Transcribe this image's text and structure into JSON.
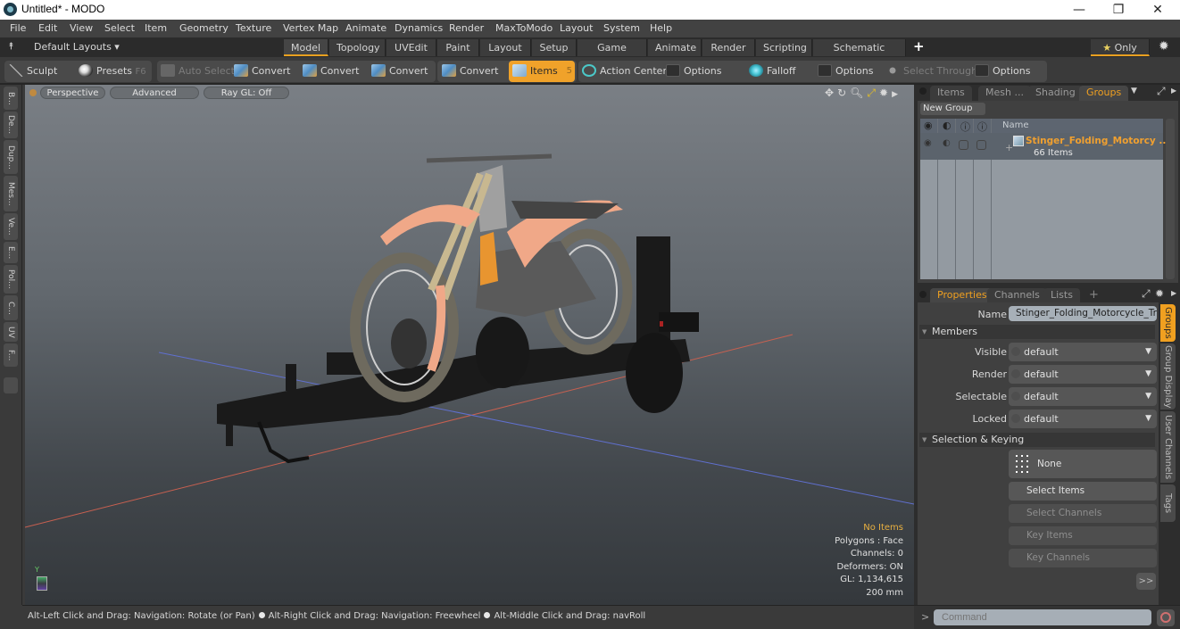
{
  "window": {
    "title": "Untitled* - MODO",
    "controls": {
      "minimize": "—",
      "restore": "❐",
      "close": "✕"
    }
  },
  "menubar": [
    "File",
    "Edit",
    "View",
    "Select",
    "Item",
    "Geometry",
    "Texture",
    "Vertex Map",
    "Animate",
    "Dynamics",
    "Render",
    "MaxToModo",
    "Layout",
    "System",
    "Help"
  ],
  "layoutbar": {
    "layouts_label": "Default Layouts ▾",
    "tabs": [
      "Model",
      "Topology",
      "UVEdit",
      "Paint",
      "Layout",
      "Setup",
      "Game Tools",
      "Animate",
      "Render",
      "Scripting",
      "Schematic Fusion"
    ],
    "active_tab": "Model",
    "add_tab": "+",
    "only_label": "★ Only",
    "accent_color": "#e8a020"
  },
  "toolbar": {
    "sculpt": "Sculpt",
    "presets": "Presets",
    "presets_shortcut": "F6",
    "auto_select": "Auto Select",
    "convert_1": "Convert",
    "convert_2": "Convert",
    "convert_3": "Convert",
    "convert_4": "Convert",
    "items": "Items",
    "items_shortcut": "5",
    "action_center": "Action Center",
    "options_1": "Options",
    "falloff": "Falloff",
    "options_2": "Options",
    "select_through": "Select Through",
    "options_3": "Options"
  },
  "left_tabs": [
    "B...",
    "De...",
    "Dup...",
    "Mes...",
    "Ve...",
    "E...",
    "Pol...",
    "C...",
    "UV",
    "F..."
  ],
  "viewport": {
    "view_mode": "Perspective",
    "shading": "Advanced",
    "raygl": "Ray GL: Off",
    "info": {
      "selection": "No Items",
      "polygons": "Polygons : Face",
      "channels": "Channels: 0",
      "deformers": "Deformers: ON",
      "gl": "GL: 1,134,615",
      "scale": "200 mm"
    },
    "axis_label": "Y"
  },
  "statusbar": {
    "hint_1": "Alt-Left Click and Drag: Navigation: Rotate (or Pan)",
    "hint_2": "Alt-Right Click and Drag: Navigation: Freewheel",
    "hint_3": "Alt-Middle Click and Drag: navRoll"
  },
  "groups_panel": {
    "tabs": [
      "Items",
      "Mesh ...",
      "Shading",
      "Groups"
    ],
    "active_tab": "Groups",
    "new_group": "New Group",
    "column_name": "Name",
    "groups": [
      {
        "name": "Stinger_Folding_Motorcy ...",
        "count": "66 Items"
      }
    ]
  },
  "properties_panel": {
    "tabs": [
      "Properties",
      "Channels",
      "Lists"
    ],
    "active_tab": "Properties",
    "add_tab": "+",
    "name_label": "Name",
    "name_value": "Stinger_Folding_Motorcycle_Trail",
    "members_section": "Members",
    "fields": [
      {
        "label": "Visible",
        "value": "default"
      },
      {
        "label": "Render",
        "value": "default"
      },
      {
        "label": "Selectable",
        "value": "default"
      },
      {
        "label": "Locked",
        "value": "default"
      }
    ],
    "selection_section": "Selection & Keying",
    "none_button": "None",
    "select_items": "Select Items",
    "select_channels": "Select Channels",
    "key_items": "Key Items",
    "key_channels": "Key Channels",
    "more": ">>",
    "side_tabs": [
      "Groups",
      "Group Display",
      "User Channels",
      "Tags"
    ],
    "active_side_tab": "Groups"
  },
  "command": {
    "prompt": ">",
    "placeholder": "Command"
  }
}
